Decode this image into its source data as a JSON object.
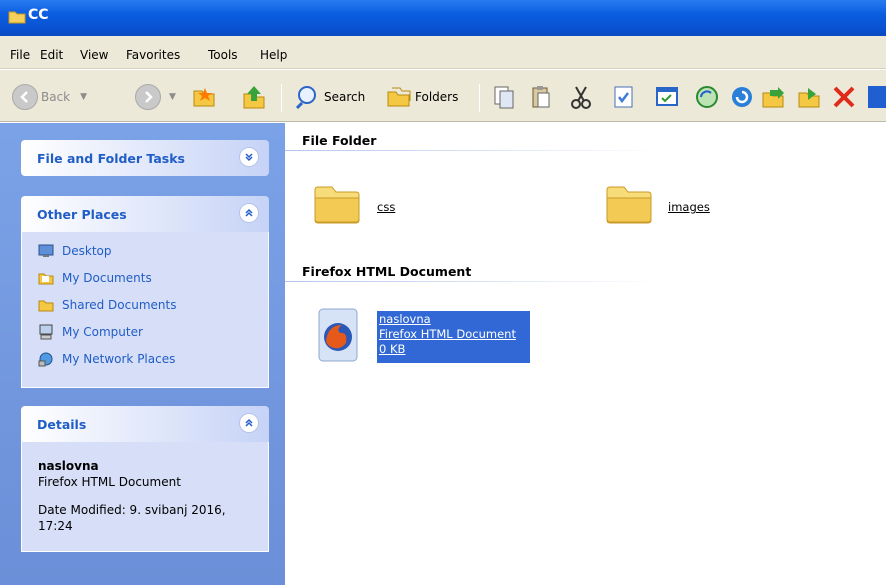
{
  "window": {
    "title": "CC"
  },
  "menu": [
    "File",
    "Edit",
    "View",
    "Favorites",
    "Tools",
    "Help"
  ],
  "toolbar": {
    "back_label": "Back",
    "search_label": "Search",
    "folders_label": "Folders"
  },
  "left": {
    "file_folder_tasks": "File and Folder Tasks",
    "other_places": {
      "title": "Other Places",
      "items": [
        "Desktop",
        "My Documents",
        "Shared Documents",
        "My Computer",
        "My Network Places"
      ]
    },
    "details": {
      "title": "Details",
      "name": "naslovna",
      "type": "Firefox HTML Document",
      "modified": "Date Modified: 9. svibanj 2016,",
      "modified_time": "17:24"
    }
  },
  "content": {
    "groups": [
      {
        "title": "File Folder",
        "items": [
          "css",
          "images"
        ]
      },
      {
        "title": "Firefox HTML Document",
        "items": [
          {
            "name": "naslovna",
            "type": "Firefox HTML Document",
            "size": "0 KB"
          }
        ]
      }
    ]
  }
}
